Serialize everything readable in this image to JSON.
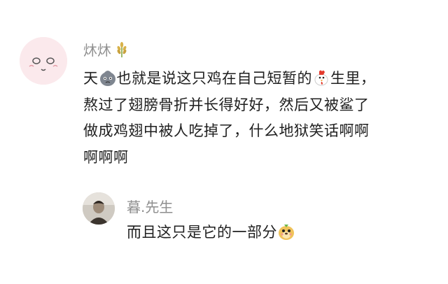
{
  "comment": {
    "username": "炑炑",
    "badge_icon": "wheat-icon",
    "avatar_icon": "cartoon-face-avatar",
    "lines": [
      [
        "天",
        "也就是说这只鸡在自己短暂的",
        "生里，"
      ],
      "熬过了翅膀骨折并长得好好，然后又被鲨了",
      "做成鸡翅中被人吃掉了，什么地狱笑话啊啊",
      "啊啊啊"
    ],
    "emojis": [
      "gray-blob-emoji",
      "chicken-emoji"
    ]
  },
  "reply": {
    "username": "暮.先生",
    "avatar_icon": "person-photo-avatar",
    "text": "而且这只是它的一部分",
    "emoji": "dog-face-emoji"
  }
}
